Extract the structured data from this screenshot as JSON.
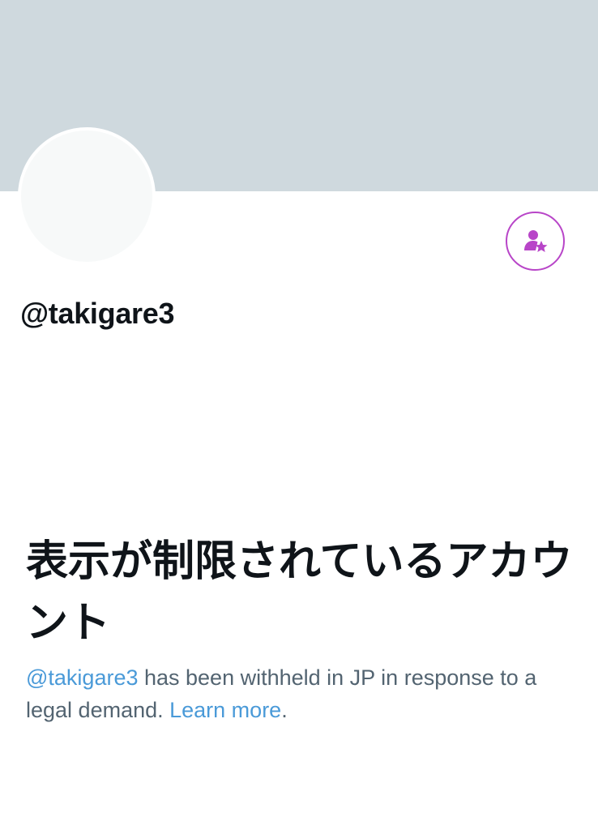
{
  "profile": {
    "handle": "@takigare3",
    "follow_icon": "person-star-icon"
  },
  "notice": {
    "title": "表示が制限されているアカウント",
    "mention": "@takigare3",
    "body_part1": " has been withheld in JP in response to a legal demand. ",
    "learn_more": "Learn more",
    "period": "."
  },
  "colors": {
    "banner": "#cfd9de",
    "accent": "#b845c8",
    "link": "#4a9ad8",
    "text_primary": "#0f1419",
    "text_secondary": "#536471"
  }
}
